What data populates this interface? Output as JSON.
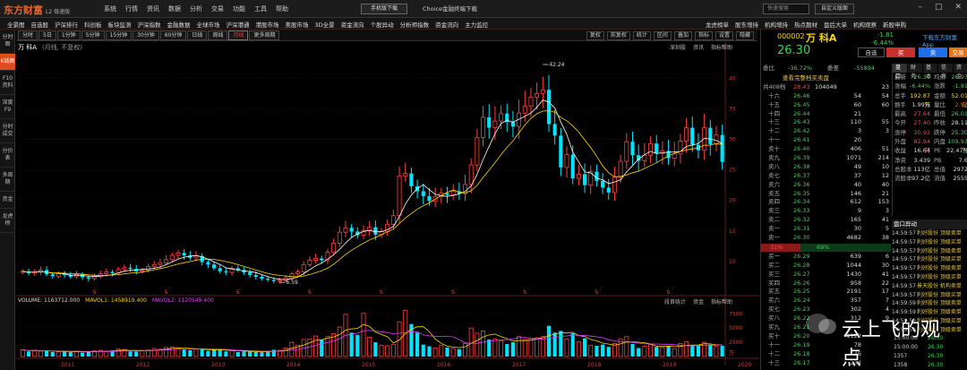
{
  "app": {
    "logo": "东方财富",
    "version": "L2 极速版",
    "menus": [
      "系统",
      "行情",
      "资讯",
      "数据",
      "分析",
      "交易",
      "功能",
      "工具",
      "帮助"
    ],
    "download_mobile": "手机版下载",
    "choice_download": "Choice金融终端下载",
    "search_placeholder": "快速搜索",
    "custom_layout": "自定义版面"
  },
  "nav_left": [
    "全景图",
    "自选股",
    "沪深排行",
    "科创板",
    "板块监测",
    "沪深指数",
    "金融数据",
    "全球市场",
    "沪深港通",
    "港股市场",
    "美股市场",
    "3D全景",
    "资金流向",
    "个股异动",
    "分析师指数",
    "资金流向",
    "主力监控"
  ],
  "nav_right": [
    "龙虎榜单",
    "股东增持",
    "机构增持",
    "热点题材",
    "盘后大单",
    "机构观察",
    "新股申购"
  ],
  "left_tabs": [
    "分时图",
    "K线图",
    "F10资料",
    "深度F9",
    "分时成交",
    "分价表",
    "多周期",
    "资金",
    "龙虎榜"
  ],
  "periods": [
    "分时",
    "5日",
    "1分钟",
    "5分钟",
    "15分钟",
    "30分钟",
    "60分钟",
    "日线",
    "周线",
    "月线",
    "更多周期"
  ],
  "active_period": "月线",
  "chart_tools": [
    "复权",
    "前复权",
    "统计",
    "区间",
    "叠加",
    "指标",
    "设置",
    "隐藏"
  ],
  "chart_links": [
    "深圳股",
    "资讯",
    "指标帮助"
  ],
  "stock_title": {
    "name": "万 科A",
    "sub": "(月线, 不复权)"
  },
  "volume_legend": {
    "vol": "VOLUME: 1163712.000",
    "ma1": "MAVOL1: 1458919.400",
    "ma2": "MAVOL2: 1120549.400"
  },
  "volume_links": [
    "段首统计",
    "资金",
    "指标帮助"
  ],
  "colors": {
    "up": "#ff4040",
    "down": "#00e5ff",
    "ma1": "#ffffff",
    "ma2": "#ffd700",
    "ma3": "#e040fb",
    "accent": "#e04d1a"
  },
  "quote": {
    "code": "000002",
    "name": "万 科A",
    "change": "-1.81",
    "change_pct": "-6.44%",
    "price": "26.30",
    "download_app": "下载东方财富App",
    "btn_watch": "自选",
    "btn_buy": "买",
    "btn_sell": "卖",
    "btn_trade": "交易"
  },
  "ratio": {
    "label1": "委比",
    "value1": "-36.72%",
    "label2": "委差",
    "value2": "-55894"
  },
  "view_all_orders": "查看完整档买卖盘",
  "ob_top": {
    "label": "共408档",
    "price": "28.43",
    "vol": "104049",
    "inc": "23"
  },
  "sell_levels": [
    {
      "label": "十六",
      "price": "26.46",
      "vol": "54",
      "inc": "54"
    },
    {
      "label": "十五",
      "price": "26.45",
      "vol": "60",
      "inc": "60"
    },
    {
      "label": "十四",
      "price": "26.44",
      "vol": "21",
      "inc": ""
    },
    {
      "label": "十三",
      "price": "26.43",
      "vol": "110",
      "inc": "55"
    },
    {
      "label": "十二",
      "price": "26.42",
      "vol": "3",
      "inc": "3"
    },
    {
      "label": "十一",
      "price": "26.41",
      "vol": "20",
      "inc": ""
    },
    {
      "label": "卖十",
      "price": "26.40",
      "vol": "406",
      "inc": "51"
    },
    {
      "label": "卖九",
      "price": "26.39",
      "vol": "1071",
      "inc": "214"
    },
    {
      "label": "卖八",
      "price": "26.38",
      "vol": "49",
      "inc": "10"
    },
    {
      "label": "卖七",
      "price": "26.37",
      "vol": "37",
      "inc": "12"
    },
    {
      "label": "卖六",
      "price": "26.36",
      "vol": "40",
      "inc": "40"
    },
    {
      "label": "卖五",
      "price": "26.35",
      "vol": "146",
      "inc": "21"
    },
    {
      "label": "卖四",
      "price": "26.34",
      "vol": "612",
      "inc": "153"
    },
    {
      "label": "卖三",
      "price": "26.33",
      "vol": "9",
      "inc": "3"
    },
    {
      "label": "卖二",
      "price": "26.32",
      "vol": "165",
      "inc": "41"
    },
    {
      "label": "卖一",
      "price": "26.31",
      "vol": "30",
      "inc": "5"
    },
    {
      "label": "卖一",
      "price": "26.30",
      "vol": "4682",
      "inc": "38"
    }
  ],
  "ob_ratio": {
    "red": "31%",
    "green": "69%"
  },
  "buy_levels": [
    {
      "label": "买一",
      "price": "26.29",
      "vol": "639",
      "inc": "6"
    },
    {
      "label": "买二",
      "price": "26.28",
      "vol": "1044",
      "inc": "30"
    },
    {
      "label": "买三",
      "price": "26.27",
      "vol": "1430",
      "inc": "41"
    },
    {
      "label": "买四",
      "price": "26.26",
      "vol": "958",
      "inc": "22"
    },
    {
      "label": "买五",
      "price": "26.25",
      "vol": "2191",
      "inc": "17"
    },
    {
      "label": "买六",
      "price": "26.24",
      "vol": "357",
      "inc": "7"
    },
    {
      "label": "买七",
      "price": "26.23",
      "vol": "302",
      "inc": "4"
    },
    {
      "label": "买八",
      "price": "26.22",
      "vol": "312",
      "inc": "9"
    },
    {
      "label": "买九",
      "price": "26.21",
      "vol": "",
      "inc": ""
    },
    {
      "label": "买十",
      "price": "26.20",
      "vol": "1122",
      "inc": ""
    },
    {
      "label": "十一",
      "price": "26.19",
      "vol": "78",
      "inc": ""
    },
    {
      "label": "十二",
      "price": "26.18",
      "vol": "46",
      "inc": ""
    },
    {
      "label": "十三",
      "price": "26.17",
      "vol": "234",
      "inc": ""
    }
  ],
  "stats_tabs": [
    "盘口",
    "财务",
    "基本",
    "信息",
    "资金"
  ],
  "stats": [
    {
      "l1": "最新",
      "v1": "26.30",
      "c1": "#39d353",
      "l2": "均价",
      "v2": "26.97",
      "c2": "#39d353"
    },
    {
      "l1": "涨幅",
      "v1": "-6.44%",
      "c1": "#39d353",
      "l2": "涨跌",
      "v2": "-1.81",
      "c2": "#39d353"
    },
    {
      "l1": "总手",
      "v1": "192.87万",
      "c1": "#ffd700",
      "l2": "金额",
      "v2": "52.01亿",
      "c2": "#ffd700"
    },
    {
      "l1": "换手",
      "v1": "1.99%",
      "c1": "#ddd",
      "l2": "量比",
      "v2": "2.97",
      "c2": "#ff4040"
    },
    {
      "l1": "最高",
      "v1": "27.64",
      "c1": "#ff4040",
      "l2": "最低",
      "v2": "26.01",
      "c2": "#39d353"
    },
    {
      "l1": "今开",
      "v1": "27.40",
      "c1": "#ff4040",
      "l2": "昨收",
      "v2": "28.11",
      "c2": "#ddd"
    },
    {
      "l1": "涨停",
      "v1": "30.92",
      "c1": "#ff4040",
      "l2": "跌停",
      "v2": "25.30",
      "c2": "#39d353"
    },
    {
      "l1": "外盘",
      "v1": "82.94万",
      "c1": "#ff4040",
      "l2": "内盘",
      "v2": "109.93万",
      "c2": "#39d353"
    },
    {
      "l1": "收益",
      "v1": "16.64",
      "c1": "#ddd",
      "l2": "PE",
      "v2": "22.47%",
      "c2": "#ddd"
    },
    {
      "l1": "净资",
      "v1": "3.439",
      "c1": "#ddd",
      "l2": "PB",
      "v2": "7.6",
      "c2": "#ddd"
    },
    {
      "l1": "总股本",
      "v1": "113亿",
      "c1": "#ddd",
      "l2": "总值",
      "v2": "2972",
      "c2": "#ddd"
    },
    {
      "l1": "流股本",
      "v1": "97.2亿",
      "c1": "#ddd",
      "l2": "流值",
      "v2": "2555",
      "c2": "#ddd"
    }
  ],
  "ticks_title": "盘口异动",
  "ticks": [
    {
      "time": "14:59:57",
      "what": "利好股份  顶级卖单"
    },
    {
      "time": "14:59:57",
      "what": "利好股份  顶级买单"
    },
    {
      "time": "14:59:57",
      "what": "利好股份  顶级卖单"
    },
    {
      "time": "14:59:57",
      "what": "利好股份  顶级买单"
    },
    {
      "time": "14:59:57",
      "what": "利好股份  顶级卖单"
    },
    {
      "time": "14:59:57",
      "what": "利好股份  顶级买单"
    },
    {
      "time": "14:59:57",
      "what": "景天股份  机构卖单"
    },
    {
      "time": "14:59:57",
      "what": "利好股份  顶级买单"
    },
    {
      "time": "14:59:59",
      "what": "利好股份  顶级卖单"
    },
    {
      "time": "14:59:59",
      "what": "利好股份  顶级卖单"
    },
    {
      "time": "14:59:59",
      "what": "利好股份  顶级买单"
    },
    {
      "time": "14:59:59",
      "what": "利好股份  顶级卖单"
    }
  ],
  "tick_bottom": [
    {
      "time": "15:00:00",
      "price": "26.30",
      "vol": ""
    },
    {
      "time": "15:00:00",
      "price": "26.30",
      "vol": ""
    },
    {
      "time": "1357",
      "price": "26.30",
      "vol": ""
    },
    {
      "time": "1358",
      "price": "26.30",
      "vol": ""
    }
  ],
  "watermark": "云上飞的观点",
  "chart_data": {
    "type": "candlestick",
    "period": "monthly",
    "x_labels": [
      "2011",
      "2012",
      "2013",
      "2014",
      "2015",
      "2016",
      "2017",
      "2018",
      "2019",
      "2020"
    ],
    "y_ticks": [
      10,
      15,
      20,
      25,
      30,
      35,
      40
    ],
    "y_range": [
      5,
      44
    ],
    "annotations": [
      {
        "text": "42.24",
        "price": 42.24,
        "index": 87
      },
      {
        "text": "6.59",
        "price": 6.59,
        "index": 43
      }
    ],
    "vol_ticks": [
      2500,
      5000,
      7500
    ],
    "vol_unit": "万",
    "vol_range": [
      0,
      8800
    ],
    "closes": [
      8.4,
      8.1,
      8.3,
      8.6,
      7.9,
      7.6,
      8.0,
      7.8,
      7.5,
      7.9,
      7.4,
      7.2,
      7.6,
      8.0,
      8.3,
      8.1,
      8.7,
      9.0,
      8.8,
      8.4,
      8.6,
      9.2,
      9.5,
      9.8,
      10.3,
      11.0,
      11.4,
      11.0,
      10.6,
      10.9,
      9.9,
      9.5,
      8.9,
      8.4,
      8.2,
      8.9,
      8.6,
      8.2,
      7.8,
      7.5,
      7.2,
      7.0,
      6.8,
      6.9,
      7.3,
      8.0,
      8.3,
      9.5,
      10.2,
      10.5,
      10.2,
      11.5,
      13.0,
      14.8,
      15.5,
      14.9,
      14.3,
      15.1,
      15.6,
      14.4,
      14.9,
      16.1,
      17.5,
      24.0,
      24.4,
      22.3,
      21.5,
      20.7,
      19.9,
      20.6,
      21.2,
      20.9,
      21.5,
      21.1,
      22.6,
      25.8,
      30.3,
      33.6,
      31.9,
      33.0,
      34.2,
      32.8,
      32.1,
      34.3,
      35.4,
      36.9,
      37.5,
      38.1,
      32.5,
      30.6,
      25.4,
      27.5,
      23.6,
      24.3,
      22.5,
      24.7,
      23.2,
      22.1,
      21.3,
      23.8,
      26.4,
      29.6,
      27.4,
      26.5,
      27.4,
      29.3,
      27.7,
      28.1,
      26.9,
      27.6,
      29.7,
      31.9,
      29.1,
      28.2,
      31.9,
      29.2,
      30.7,
      26.3
    ],
    "volumes": [
      1200,
      900,
      1100,
      950,
      1000,
      800,
      850,
      900,
      780,
      950,
      700,
      820,
      1000,
      1100,
      900,
      1050,
      1300,
      1250,
      900,
      880,
      1000,
      1150,
      1400,
      1300,
      1600,
      1700,
      1500,
      1250,
      1100,
      1300,
      1400,
      1000,
      1200,
      1150,
      900,
      1100,
      800,
      900,
      850,
      800,
      750,
      1000,
      1200,
      1100,
      1500,
      2500,
      2000,
      3000,
      3100,
      3600,
      3000,
      3500,
      4000,
      5200,
      7400,
      4200,
      3800,
      7600,
      3400,
      2500,
      2000,
      1900,
      2100,
      6100,
      8100,
      5700,
      4200,
      2100,
      1800,
      1500,
      2000,
      1600,
      1400,
      1300,
      2300,
      5000,
      4100,
      4500,
      3000,
      3100,
      2800,
      2200,
      2500,
      3500,
      3000,
      3200,
      3300,
      3500,
      5400,
      4200,
      4500,
      3100,
      4100,
      2600,
      3200,
      2000,
      1900,
      2100,
      1700,
      2300,
      3100,
      3500,
      2200,
      1500,
      1800,
      2100,
      1700,
      1600,
      1900,
      1400,
      2300,
      2600,
      1900,
      2000,
      2500,
      2100,
      1800,
      1900
    ]
  }
}
